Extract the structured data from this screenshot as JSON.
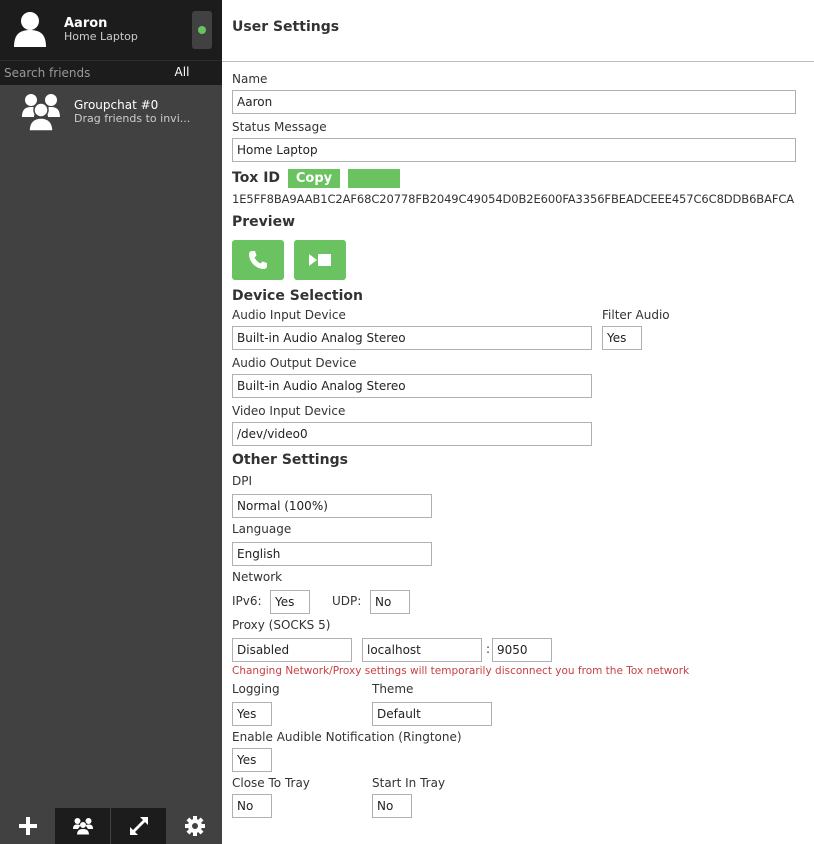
{
  "sidebar": {
    "self": {
      "name": "Aaron",
      "status": "Home Laptop",
      "online": true
    },
    "search": {
      "placeholder": "Search friends",
      "filter_label": "All"
    },
    "groupchat": {
      "name": "Groupchat #0",
      "description": "Drag friends to invi..."
    },
    "toolbar": {
      "add_icon": "plus-icon",
      "group_icon": "groupchat-icon",
      "transfer_icon": "transfer-icon",
      "settings_icon": "gear-icon"
    }
  },
  "settings": {
    "title": "User Settings",
    "name_label": "Name",
    "name_value": "Aaron",
    "status_label": "Status Message",
    "status_value": "Home Laptop",
    "tox_id_label": "Tox ID",
    "copy_label": "Copy",
    "tox_id": "1E5FF8BA9AAB1C2AF68C20778FB2049C49054D0B2E600FA3356FBEADCEEE457C6C8DDB6BAFCA",
    "preview_heading": "Preview",
    "device_heading": "Device Selection",
    "audio_input_label": "Audio Input Device",
    "audio_input_value": "Built-in Audio Analog Stereo",
    "filter_audio_label": "Filter Audio",
    "filter_audio_value": "Yes",
    "audio_output_label": "Audio Output Device",
    "audio_output_value": "Built-in Audio Analog Stereo",
    "video_input_label": "Video Input Device",
    "video_input_value": "/dev/video0",
    "other_heading": "Other Settings",
    "dpi_label": "DPI",
    "dpi_value": "Normal (100%)",
    "language_label": "Language",
    "language_value": "English",
    "network_label": "Network",
    "ipv6_label": "IPv6:",
    "ipv6_value": "Yes",
    "udp_label": "UDP:",
    "udp_value": "No",
    "proxy_label": "Proxy (SOCKS 5)",
    "proxy_value": "Disabled",
    "proxy_host": "localhost",
    "proxy_sep": ":",
    "proxy_port": "9050",
    "warning": "Changing Network/Proxy settings will temporarily disconnect you from the Tox network",
    "logging_label": "Logging",
    "logging_value": "Yes",
    "theme_label": "Theme",
    "theme_value": "Default",
    "ringtone_label": "Enable Audible Notification (Ringtone)",
    "ringtone_value": "Yes",
    "close_tray_label": "Close To Tray",
    "close_tray_value": "No",
    "start_tray_label": "Start In Tray",
    "start_tray_value": "No"
  },
  "colors": {
    "accent": "#6bc260",
    "sidebar_bg": "#414141",
    "sidebar_dark": "#1c1c1c",
    "warning": "#c84040"
  }
}
